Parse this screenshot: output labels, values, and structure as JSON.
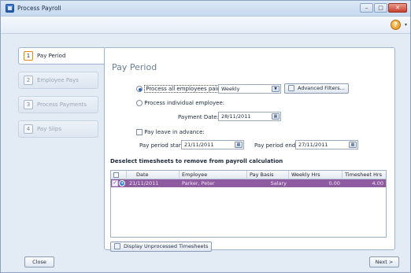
{
  "window": {
    "title": "Process Payroll"
  },
  "steps": [
    {
      "num": "1",
      "label": "Pay Period",
      "active": true
    },
    {
      "num": "2",
      "label": "Employee Pays",
      "active": false
    },
    {
      "num": "3",
      "label": "Process Payments",
      "active": false
    },
    {
      "num": "4",
      "label": "Pay Slips",
      "active": false
    }
  ],
  "panel": {
    "title": "Pay Period",
    "process_all_label": "Process all employees paid:",
    "frequency_value": "Weekly",
    "advanced_filters_label": "Advanced Filters...",
    "process_individual_label": "Process individual employee:",
    "payment_date_label": "Payment Date:",
    "payment_date_value": "28/11/2011",
    "pay_leave_label": "Pay leave in advance:",
    "pay_period_start_label": "Pay period start:",
    "pay_period_start_value": "21/11/2011",
    "pay_period_end_label": "Pay period end:",
    "pay_period_end_value": "27/11/2011",
    "deselect_heading": "Deselect timesheets to remove from payroll calculation",
    "display_unprocessed_label": "Display Unprocessed Timesheets"
  },
  "grid": {
    "columns": [
      "Date",
      "Employee",
      "Pay Basis",
      "Weekly Hrs",
      "Timesheet Hrs"
    ],
    "rows": [
      {
        "date": "21/11/2011",
        "employee": "Parker, Peter",
        "pay_basis": "Salary",
        "weekly_hrs": "0.00",
        "timesheet_hrs": "4.00"
      }
    ]
  },
  "footer": {
    "close_label": "Close",
    "next_label": "Next >"
  },
  "colors": {
    "selected_row": "#8e5ba0",
    "accent": "#e08a12"
  }
}
